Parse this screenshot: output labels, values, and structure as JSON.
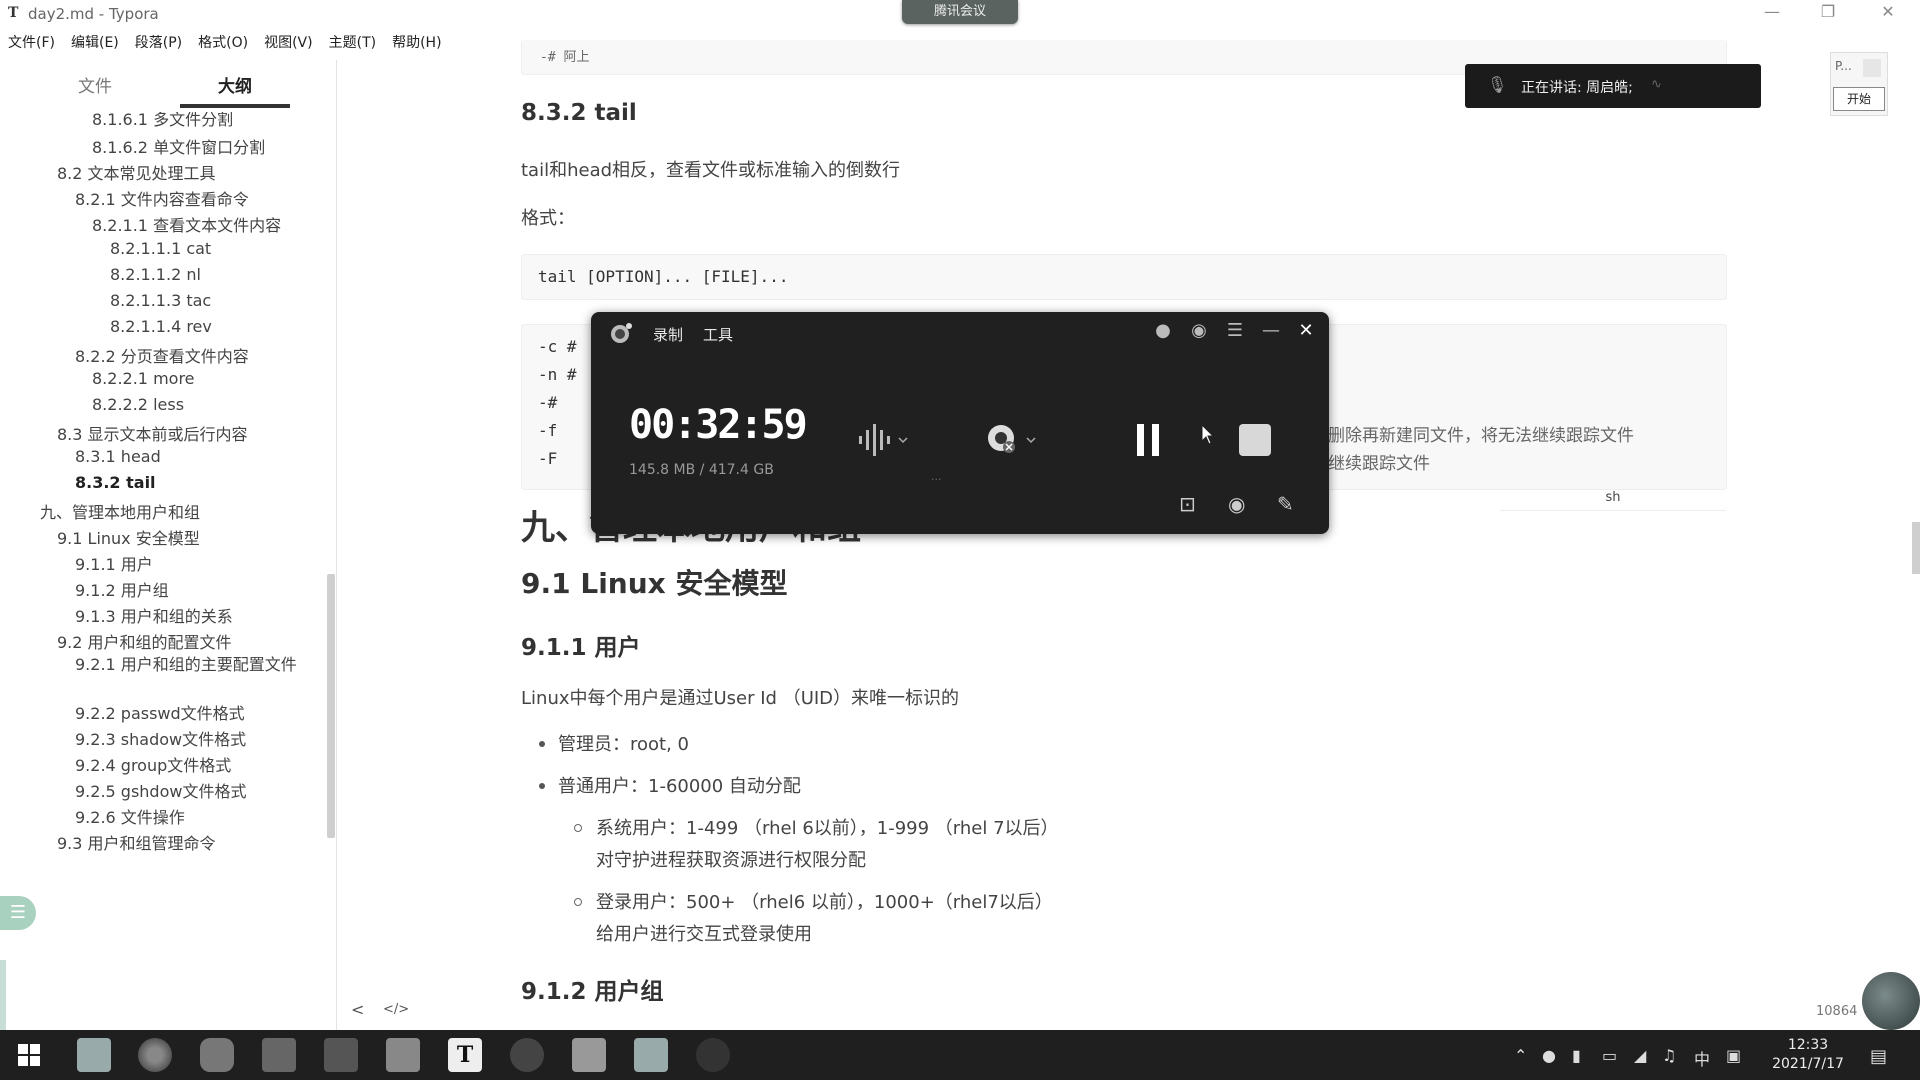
{
  "window": {
    "app_icon": "T",
    "title": "day2.md - Typora",
    "meeting_tab": "腾讯会议"
  },
  "menu": [
    "文件(F)",
    "编辑(E)",
    "段落(P)",
    "格式(O)",
    "视图(V)",
    "主题(T)",
    "帮助(H)"
  ],
  "sidebar": {
    "tabs": {
      "files": "文件",
      "outline": "大纲"
    },
    "outline": [
      "8.1.6.1 多文件分割",
      "8.1.6.2 单文件窗口分割",
      "8.2 文本常见处理工具",
      "8.2.1 文件内容查看命令",
      "8.2.1.1 查看文本文件内容",
      "8.2.1.1.1 cat",
      "8.2.1.1.2 nl",
      "8.2.1.1.3 tac",
      "8.2.1.1.4 rev",
      "8.2.2 分页查看文件内容",
      "8.2.2.1 more",
      "8.2.2.2 less",
      "8.3 显示文本前或后行内容",
      "8.3.1 head",
      "8.3.2 tail",
      "九、管理本地用户和组",
      "9.1 Linux 安全模型",
      "9.1.1 用户",
      "9.1.2 用户组",
      "9.1.3 用户和组的关系",
      "9.2 用户和组的配置文件",
      "9.2.1 用户和组的主要配置文件",
      "9.2.2 passwd文件格式",
      "9.2.3 shadow文件格式",
      "9.2.4 group文件格式",
      "9.2.5 gshdow文件格式",
      "9.2.6 文件操作",
      "9.3 用户和组管理命令"
    ],
    "active_item": "8.3.2 tail"
  },
  "editor": {
    "top_clip": "-#          阿上",
    "h_tail": "8.3.2 tail",
    "tail_desc": "tail和head相反，查看文件或标准输入的倒数行",
    "format_label": "格式：",
    "syntax": "tail [OPTION]... [FILE]...",
    "options": [
      "-c #",
      "-n #",
      "-#",
      "-f",
      "-F"
    ],
    "option_tail_1": "删除再新建同文件，将无法继续跟踪文件",
    "option_tail_2": "继续跟踪文件",
    "code_lang": "sh",
    "h_chapter": "九、管理本地用户和组",
    "h_security": "9.1 Linux 安全模型",
    "h_user": "9.1.1 用户",
    "uid_desc": "Linux中每个用户是通过User Id （UID）来唯一标识的",
    "bullet_admin": "管理员：root, 0",
    "bullet_normal": "普通用户：1-60000 自动分配",
    "sub_system": "系统用户：1-499 （rhel 6以前），1-999 （rhel 7以后）",
    "sub_system_desc": "对守护进程获取资源进行权限分配",
    "sub_login": "登录用户：500+ （rhel6 以前），1000+（rhel7以后）",
    "sub_login_desc": "给用户进行交互式登录使用",
    "h_group": "9.1.2 用户组"
  },
  "editor_bottom": {
    "prev": "<",
    "source": "</>",
    "word_count": "10864"
  },
  "meeting": {
    "speaking_label": "正在讲话: 周启皓;",
    "mini_label": "P...",
    "start_button": "开始"
  },
  "recorder": {
    "menu_record": "录制",
    "menu_tools": "工具",
    "timer": "00:32:59",
    "storage": "145.8 MB / 417.4 GB"
  },
  "taskbar": {
    "ime": "中",
    "time": "12:33",
    "date": "2021/7/17"
  }
}
